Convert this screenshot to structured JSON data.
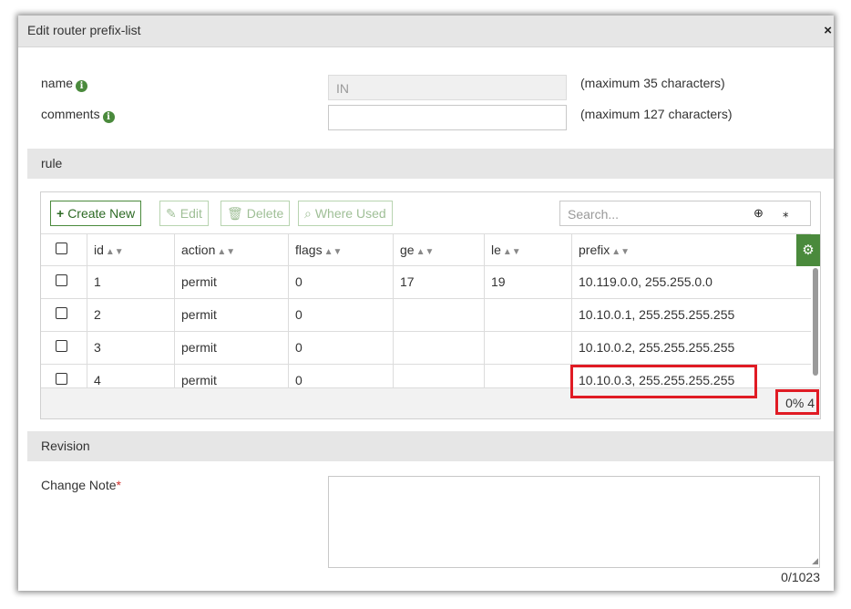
{
  "dialog": {
    "title": "Edit router prefix-list",
    "close_symbol": "×"
  },
  "fields": {
    "name": {
      "label": "name",
      "value": "IN",
      "hint": "(maximum 35 characters)"
    },
    "comments": {
      "label": "comments",
      "value": "",
      "hint": "(maximum 127 characters)"
    }
  },
  "sections": {
    "rule": "rule",
    "revision": "Revision"
  },
  "toolbar": {
    "create_new": "Create New",
    "edit": "Edit",
    "delete": "Delete",
    "where_used": "Where Used",
    "search_placeholder": "Search..."
  },
  "table": {
    "headers": [
      "id",
      "action",
      "flags",
      "ge",
      "le",
      "prefix"
    ],
    "rows": [
      {
        "id": "1",
        "action": "permit",
        "flags": "0",
        "ge": "17",
        "le": "19",
        "prefix": "10.119.0.0, 255.255.0.0"
      },
      {
        "id": "2",
        "action": "permit",
        "flags": "0",
        "ge": "",
        "le": "",
        "prefix": "10.10.0.1, 255.255.255.255"
      },
      {
        "id": "3",
        "action": "permit",
        "flags": "0",
        "ge": "",
        "le": "",
        "prefix": "10.10.0.2, 255.255.255.255"
      },
      {
        "id": "4",
        "action": "permit",
        "flags": "0",
        "ge": "",
        "le": "",
        "prefix": "10.10.0.3, 255.255.255.255"
      }
    ],
    "footer": "0% 4"
  },
  "change_note": {
    "label": "Change Note",
    "required_mark": "*",
    "counter": "0/1023"
  },
  "colors": {
    "accent": "#4a8a3c",
    "highlight": "#e01b24",
    "header_bg": "#e6e6e6"
  }
}
